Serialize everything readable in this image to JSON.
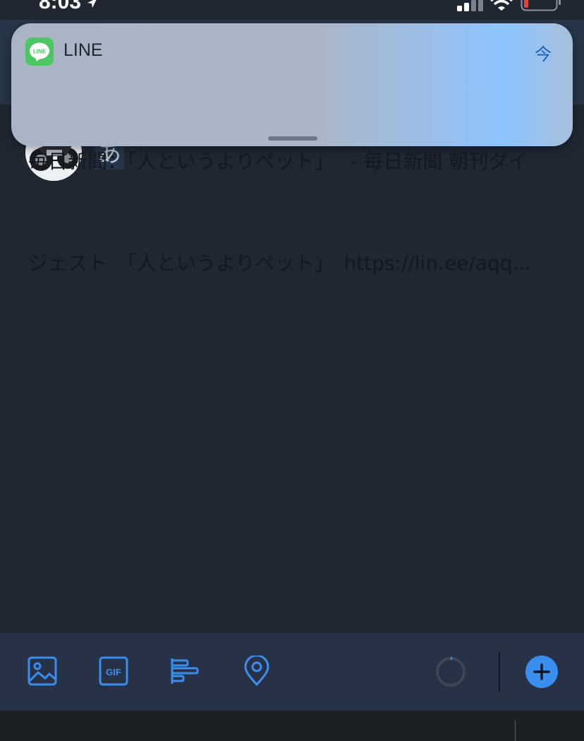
{
  "status_bar": {
    "time": "8:03",
    "location_arrow": "location-arrow-icon",
    "signal_icon": "cellular-signal-icon",
    "wifi_icon": "wifi-icon",
    "battery_icon": "battery-low-icon",
    "battery_color": "#e0443a"
  },
  "notification": {
    "app_name": "LINE",
    "app_icon_text": "LINE",
    "app_icon_color": "#4cc764",
    "time": "今",
    "line1": "毎日新聞：「人というよりペット」　 - 毎日新聞 朝刊ダイ",
    "line2": "ジェスト　「人というよりペット」　https://lin.ee/aqq..."
  },
  "compose": {
    "text": "あ",
    "avatar": "profile-avatar-motorcycle"
  },
  "toolbar": {
    "accent": "#3a8ef0",
    "icons": [
      "image-icon",
      "gif-icon",
      "poll-icon",
      "location-pin-icon"
    ],
    "gif_label": "GIF",
    "progress_icon": "character-count-ring-icon",
    "add_icon": "plus-icon"
  }
}
